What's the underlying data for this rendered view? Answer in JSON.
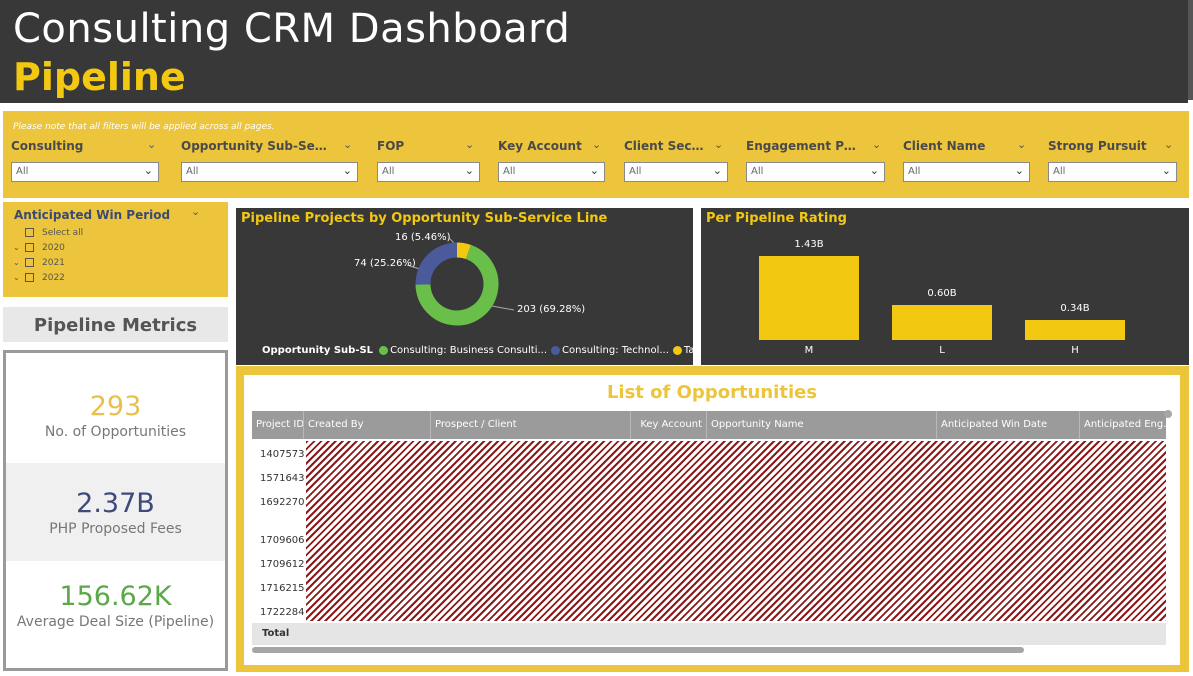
{
  "header": {
    "title": "Consulting CRM Dashboard",
    "subtitle": "Pipeline"
  },
  "filters": {
    "note": "Please note that all filters will be applied across all pages.",
    "slicers": [
      {
        "label": "Consulting",
        "value": "All"
      },
      {
        "label": "Opportunity Sub-Servi...",
        "value": "All"
      },
      {
        "label": "FOP",
        "value": "All"
      },
      {
        "label": "Key Account",
        "value": "All"
      },
      {
        "label": "Client Sec...",
        "value": "All"
      },
      {
        "label": "Engagement Pa...",
        "value": "All"
      },
      {
        "label": "Client Name",
        "value": "All"
      },
      {
        "label": "Strong Pursuit",
        "value": "All"
      }
    ]
  },
  "win_period": {
    "label": "Anticipated Win Period",
    "items": [
      "Select all",
      "2020",
      "2021",
      "2022"
    ]
  },
  "metrics": {
    "title": "Pipeline Metrics",
    "items": [
      {
        "value": "293",
        "caption": "No. of Opportunities",
        "color": "#e8c14a"
      },
      {
        "value": "2.37B",
        "caption": "PHP Proposed Fees",
        "color": "#3e4a7a"
      },
      {
        "value": "156.62K",
        "caption": "Average Deal Size (Pipeline)",
        "color": "#5aa84a"
      }
    ]
  },
  "donut": {
    "title": "Pipeline Projects by Opportunity Sub-Service Line",
    "legend_title": "Opportunity Sub-SL",
    "slices": [
      {
        "name": "Consulting: Business Consulti...",
        "value": 203,
        "label": "203 (69.28%)",
        "color": "#6abf4b"
      },
      {
        "name": "Consulting: Technol...",
        "value": 74,
        "label": "74 (25.26%)",
        "color": "#4a5a9a"
      },
      {
        "name": "Tax: PAS",
        "value": 16,
        "label": "16 (5.46%)",
        "color": "#f2c811"
      }
    ]
  },
  "chart_data": {
    "type": "bar",
    "title": "Per Pipeline Rating",
    "categories": [
      "M",
      "L",
      "H"
    ],
    "values": [
      1.43,
      0.6,
      0.34
    ],
    "value_labels": [
      "1.43B",
      "0.60B",
      "0.34B"
    ],
    "ylim": [
      0,
      1.43
    ],
    "color": "#f2c811"
  },
  "list": {
    "title": "List of Opportunities",
    "columns": [
      "Project ID",
      "Created By",
      "Prospect / Client",
      "Key Account",
      "Opportunity Name",
      "Anticipated Win Date",
      "Anticipated Eng. P"
    ],
    "project_ids": [
      "1407573",
      "1571643",
      "1692270",
      "1709606",
      "1709612",
      "1716215",
      "1722284"
    ],
    "total_label": "Total"
  }
}
